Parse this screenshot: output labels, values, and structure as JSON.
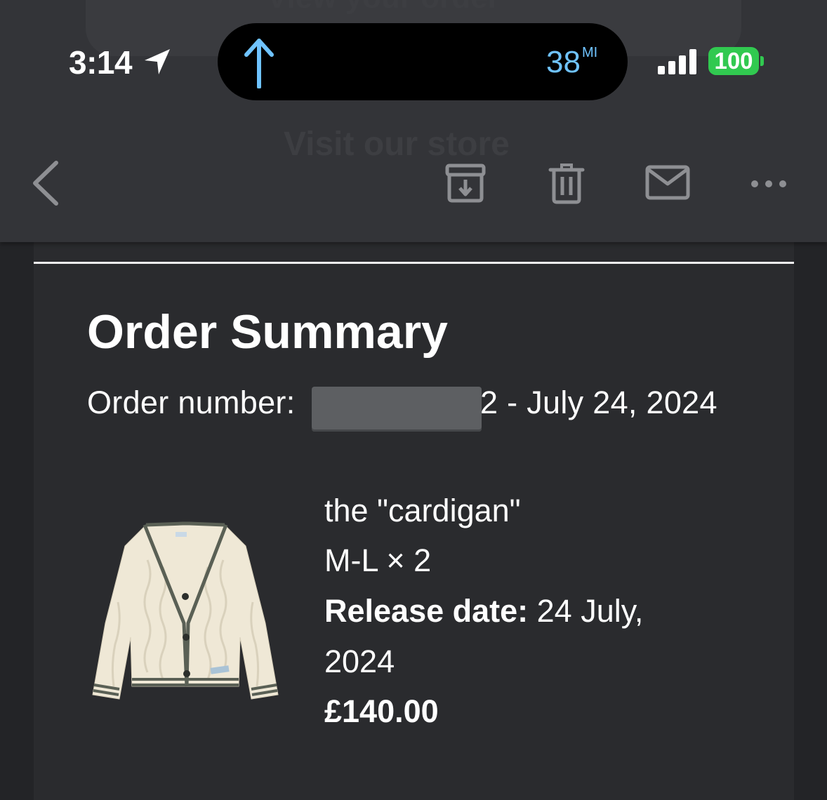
{
  "ghost": {
    "top_button": "View your order",
    "store_link": "Visit our store"
  },
  "status_bar": {
    "time": "3:14",
    "nav_distance": "38",
    "nav_unit": "MI",
    "battery": "100",
    "battery_color": "#31c950",
    "nav_color": "#6fc3ff"
  },
  "toolbar": {
    "icons": [
      "back-icon",
      "archive-icon",
      "trash-icon",
      "mail-icon",
      "more-icon"
    ]
  },
  "email": {
    "title": "Order Summary",
    "order_label": "Order number: ",
    "order_suffix": "2 - July 24, 2024",
    "product": {
      "name": "the \"cardigan\"",
      "variant": "M-L × 2",
      "release_label": "Release date:",
      "release_value": " 24 July,",
      "release_year": "2024",
      "price": "£140.00"
    }
  }
}
